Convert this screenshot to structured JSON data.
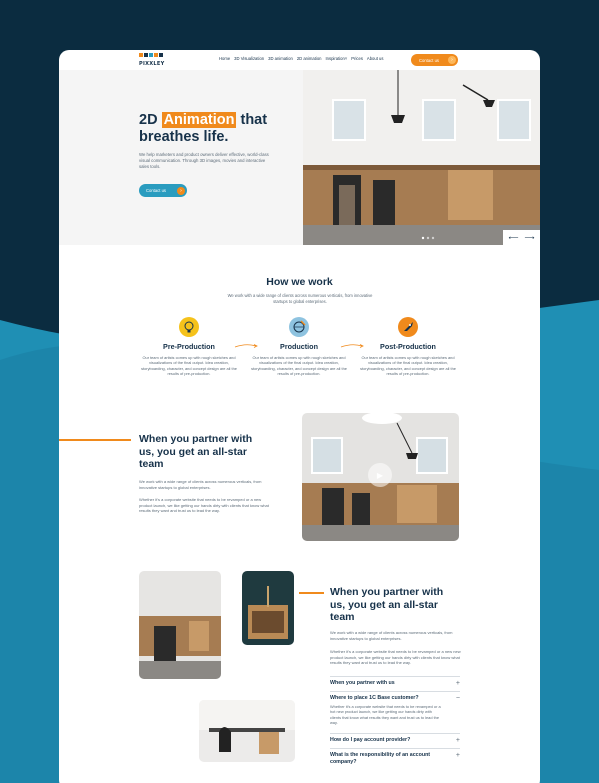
{
  "brand": {
    "name": "PIXXLEY",
    "colors": {
      "orange": "#f08a1c",
      "teal": "#2a9cbf",
      "navy": "#0b2c40"
    }
  },
  "nav": {
    "items": [
      "Home",
      "3D Visualization",
      "3D animation",
      "2D animation",
      "Inspiration",
      "Prices",
      "About us"
    ],
    "cta": "Contact us"
  },
  "hero": {
    "title_pre": "2D",
    "title_highlight": "Animation",
    "title_post": "that breathes life.",
    "body": "We help marketers and product owners deliver effective, world-class visual communication. Through 3D images, movies and interactive sales tools.",
    "cta": "Contact us",
    "arrow_prev": "⟵",
    "arrow_next": "⟶"
  },
  "how": {
    "title": "How we work",
    "subtitle": "We work with a wide range of clients across numerous verticals, from innovative startups to global enterprises.",
    "steps": [
      {
        "title": "Pre-Production",
        "icon": "lightbulb-icon",
        "text": "Our team of artists comes up with rough sketches and visualizations of the final output. Idea creation, storyboarding, character, and concept design are all the results of pre-production."
      },
      {
        "title": "Production",
        "icon": "globe-pencil-icon",
        "text": "Our team of artists comes up with rough sketches and visualizations of the final output. Idea creation, storyboarding, character, and concept design are all the results of pre-production."
      },
      {
        "title": "Post-Production",
        "icon": "rocket-icon",
        "text": "Our team of artists comes up with rough sketches and visualizations of the final output. Idea creation, storyboarding, character, and concept design are all the results of pre-production."
      }
    ]
  },
  "partner1": {
    "title": "When you partner with us, you get an all-star team",
    "p1": "We work with a wide range of clients across numerous verticals, from innovative startups to global enterprises.",
    "p2": "Whether it's a corporate website that needs to be revamped or a new product launch, we like getting our hands dirty with clients that know what results they want and trust us to lead the way."
  },
  "partner2": {
    "title": "When you partner with us, you get an all-star team",
    "p1": "We work with a wide range of clients across numerous verticals, from innovative startups to global enterprises.",
    "p2": "Whether it's a corporate website that needs to be revamped or a new new product launch, we like getting our hands dirty with clients that know what results they want and trust us to lead the way.",
    "faq": [
      {
        "q": "When you partner with us",
        "sign": "+"
      },
      {
        "q": "Where to place 1C Base customer?",
        "sign": "−",
        "a": "Whether it's a corporate website that needs to be revamped or a hot new product launch, we like getting our hands dirty with clients that know what results they want and trust us to lead the way."
      },
      {
        "q": "How do I pay account provider?",
        "sign": "+"
      },
      {
        "q": "What is the responsibility of an account company?",
        "sign": "+"
      }
    ]
  }
}
